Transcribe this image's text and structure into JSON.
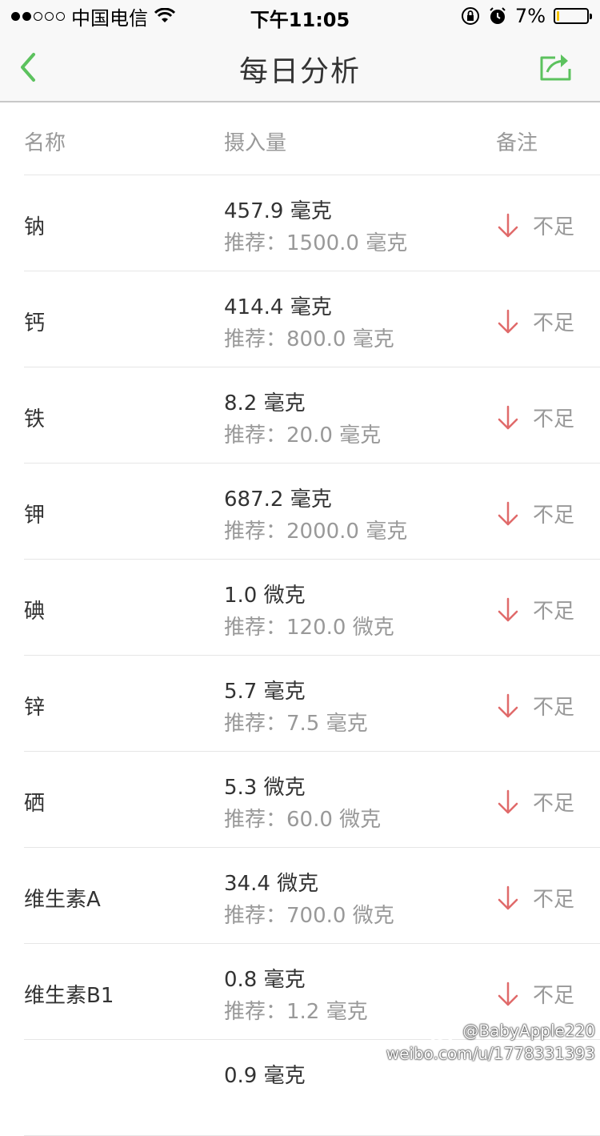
{
  "status_bar": {
    "carrier": "中国电信",
    "time": "下午11:05",
    "battery_percent": "7%",
    "battery_level": 0.07,
    "signal_dots_filled": 2,
    "signal_dots_total": 5,
    "icons": [
      "signal-dots-icon",
      "wifi-icon",
      "orientation-lock-icon",
      "alarm-icon",
      "battery-icon"
    ]
  },
  "nav": {
    "title": "每日分析",
    "accent_color": "#5cc25e",
    "back_icon": "chevron-left-icon",
    "share_icon": "share-icon"
  },
  "table": {
    "headers": {
      "name": "名称",
      "amount": "摄入量",
      "note": "备注"
    },
    "rows": [
      {
        "name": "钠",
        "amount": "457.9 毫克",
        "recommend": "推荐：1500.0 毫克",
        "note": "不足",
        "note_icon": "arrow-down-icon"
      },
      {
        "name": "钙",
        "amount": "414.4 毫克",
        "recommend": "推荐：800.0 毫克",
        "note": "不足",
        "note_icon": "arrow-down-icon"
      },
      {
        "name": "铁",
        "amount": "8.2 毫克",
        "recommend": "推荐：20.0 毫克",
        "note": "不足",
        "note_icon": "arrow-down-icon"
      },
      {
        "name": "钾",
        "amount": "687.2 毫克",
        "recommend": "推荐：2000.0 毫克",
        "note": "不足",
        "note_icon": "arrow-down-icon"
      },
      {
        "name": "碘",
        "amount": "1.0 微克",
        "recommend": "推荐：120.0 微克",
        "note": "不足",
        "note_icon": "arrow-down-icon"
      },
      {
        "name": "锌",
        "amount": "5.7 毫克",
        "recommend": "推荐：7.5 毫克",
        "note": "不足",
        "note_icon": "arrow-down-icon"
      },
      {
        "name": "硒",
        "amount": "5.3 微克",
        "recommend": "推荐：60.0 微克",
        "note": "不足",
        "note_icon": "arrow-down-icon"
      },
      {
        "name": "维生素A",
        "amount": "34.4 微克",
        "recommend": "推荐：700.0 微克",
        "note": "不足",
        "note_icon": "arrow-down-icon"
      },
      {
        "name": "维生素B1",
        "amount": "0.8 毫克",
        "recommend": "推荐：1.2 毫克",
        "note": "不足",
        "note_icon": "arrow-down-icon"
      },
      {
        "name": "",
        "amount": "0.9 毫克",
        "recommend": "",
        "note": "",
        "note_icon": ""
      }
    ],
    "arrow_color": "#e06a6a"
  },
  "watermark": {
    "handle": "@BabyApple220",
    "url": "weibo.com/u/1778331393"
  }
}
